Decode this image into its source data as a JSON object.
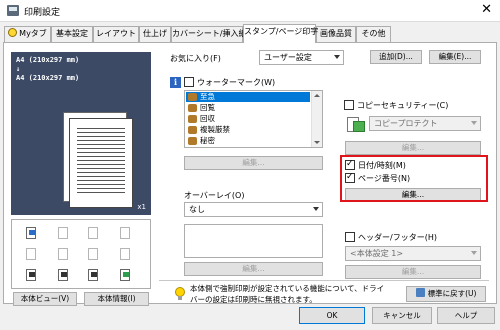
{
  "window": {
    "title": "印刷設定",
    "close_glyph": "✕"
  },
  "tabs": [
    {
      "label": "Myタブ",
      "active": false
    },
    {
      "label": "基本設定",
      "active": false
    },
    {
      "label": "レイアウト",
      "active": false
    },
    {
      "label": "仕上げ",
      "active": false
    },
    {
      "label": "カバーシート/挿入紙",
      "active": false
    },
    {
      "label": "スタンプ/ページ印字",
      "active": true
    },
    {
      "label": "画像品質",
      "active": false
    },
    {
      "label": "その他",
      "active": false
    }
  ],
  "preview": {
    "line1": "A4 (210x297 mm)",
    "arrow": "↓",
    "line2": "A4 (210x297 mm)",
    "copies": "x1"
  },
  "left_buttons": {
    "view": "本体ビュー(V)",
    "info": "本体情報(I)"
  },
  "favorites": {
    "label": "お気に入り(F)",
    "value": "ユーザー設定",
    "add": "追加(D)...",
    "edit": "編集(E)..."
  },
  "watermark": {
    "label": "ウォーターマーク(W)",
    "checked": false,
    "items": [
      "至急",
      "回覧",
      "回収",
      "複製厳禁",
      "秘密"
    ],
    "edit": "編集..."
  },
  "overlay": {
    "label": "オーバーレイ(O)",
    "value": "なし",
    "edit": "編集..."
  },
  "copy_security": {
    "label": "コピーセキュリティー(C)",
    "checked": false,
    "value": "コピープロテクト",
    "edit": "編集..."
  },
  "date_time": {
    "label": "日付/時刻(M)",
    "checked": true
  },
  "page_number": {
    "label": "ページ番号(N)",
    "checked": true,
    "edit": "編集..."
  },
  "header_footer": {
    "label": "ヘッダー/フッター(H)",
    "checked": false,
    "value": "<本体設定 1>",
    "edit": "編集..."
  },
  "note": {
    "line1": "本体側で強制印刷が設定されている機能について、ドライ",
    "line2": "バーの設定は印刷時に無視されます。"
  },
  "restore": "標準に戻す(U)",
  "footer": {
    "ok": "OK",
    "cancel": "キャンセル",
    "help": "ヘルプ"
  },
  "colors": {
    "highlight_box": "#e0151c",
    "selection": "#0078d7",
    "preview_bg": "#3c4a66"
  }
}
